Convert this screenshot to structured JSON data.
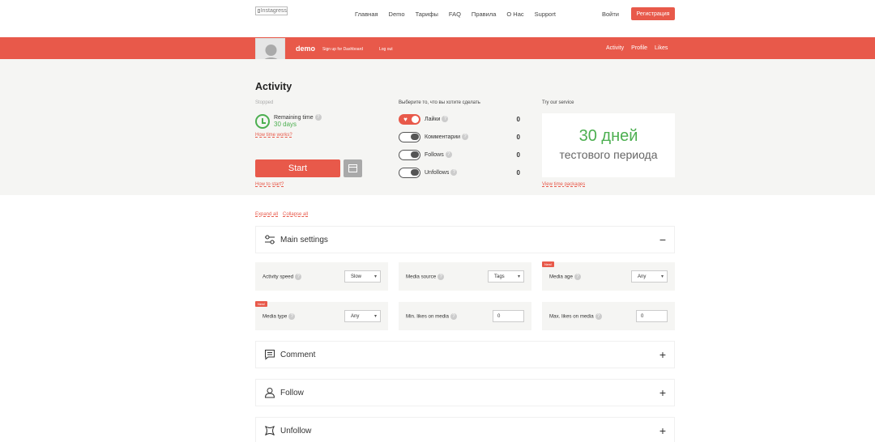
{
  "header": {
    "logo_alt": "Instagress",
    "menu": [
      "Главная",
      "Demo",
      "Тарифы",
      "FAQ",
      "Правила",
      "О Нас",
      "Support"
    ],
    "login": "Войти",
    "register": "Регистрация"
  },
  "userbar": {
    "username": "demo",
    "sign_up": "Sign up for Dashboard",
    "logout": "Log out",
    "right_links": [
      "Activity",
      "Profile",
      "Likes"
    ]
  },
  "activity": {
    "title": "Activity",
    "status": "Stopped",
    "remaining_label": "Remaining time",
    "remaining_value": "30 days",
    "how_time_works": "How time works?",
    "start": "Start",
    "how_to_start": "How to start?"
  },
  "choose": {
    "title": "Выберите то, что вы хотите сделать",
    "items": [
      {
        "label": "Лайки",
        "count": "0",
        "on": true
      },
      {
        "label": "Комментарии",
        "count": "0",
        "on": false
      },
      {
        "label": "Follows",
        "count": "0",
        "on": false
      },
      {
        "label": "Unfollows",
        "count": "0",
        "on": false
      }
    ]
  },
  "promo": {
    "title": "Try our service",
    "big": "30 дней",
    "small": "тестового периода",
    "link": "View time packages"
  },
  "controls": {
    "expand_all": "Expand all",
    "collapse_all": "Collapse all"
  },
  "sections": {
    "main_settings": "Main settings",
    "comment": "Comment",
    "follow": "Follow",
    "unfollow": "Unfollow"
  },
  "settings": {
    "new_badge": "New!",
    "activity_speed": {
      "label": "Activity speed",
      "value": "Slow"
    },
    "media_source": {
      "label": "Media source",
      "value": "Tags"
    },
    "media_age": {
      "label": "Media age",
      "value": "Any"
    },
    "media_type": {
      "label": "Media type",
      "value": "Any"
    },
    "min_likes": {
      "label": "Min. likes on media",
      "value": "0"
    },
    "max_likes": {
      "label": "Max. likes on media",
      "value": "0"
    }
  },
  "colors": {
    "accent": "#e8594a",
    "green": "#4caf50",
    "panel": "#f5f5f3"
  }
}
